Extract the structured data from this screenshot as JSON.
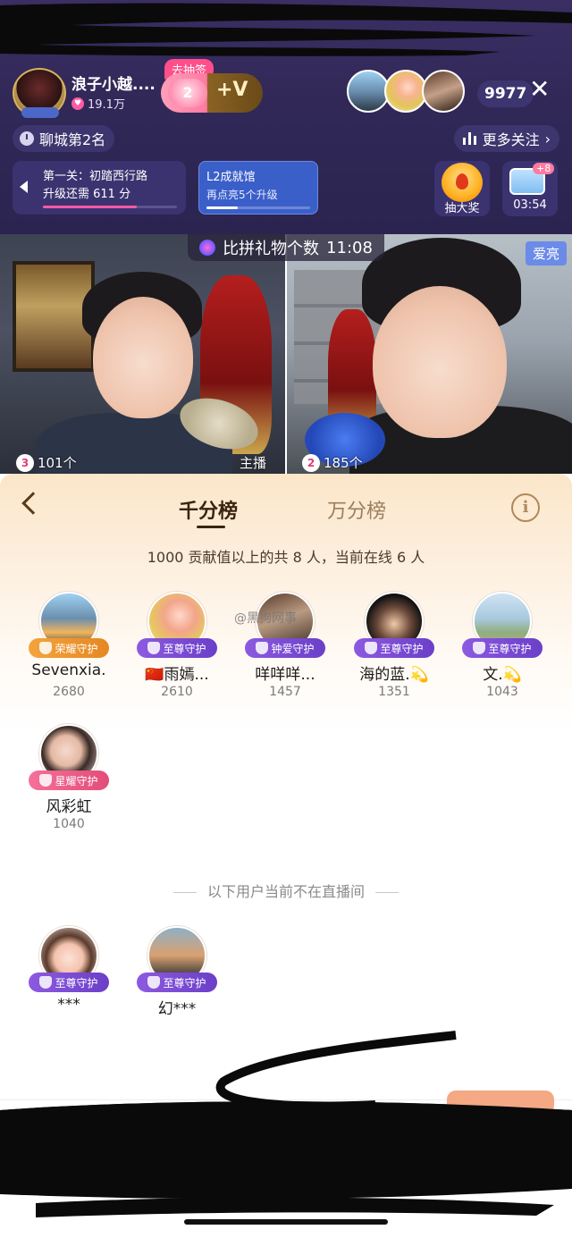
{
  "header": {
    "host_name": "浪子小越....",
    "host_fans": "19.1万",
    "lottery_tag": "去抽签",
    "lottery_level": "2",
    "lottery_v": "+V",
    "viewer_count": "9977",
    "city_rank": "聊城第2名",
    "more_follow": "更多关注",
    "task1_line1": "第一关：初踏西行路",
    "task1_line2": "升级还需 611 分",
    "task1_progress": 0.7,
    "task2_line1": "L2成就馆",
    "task2_line2": "再点亮5个升级",
    "task2_progress": 0.3,
    "draw_prize": "抽大奖",
    "gift_plus": "+8",
    "timer": "03:54"
  },
  "video": {
    "contest_title": "比拼礼物个数",
    "contest_time": "11:08",
    "right_tag": "爱亮",
    "left_rank": "3",
    "left_count": "101个",
    "host_label": "主播",
    "right_rank": "2",
    "right_count": "185个"
  },
  "panel": {
    "tab_active": "千分榜",
    "tab_inactive": "万分榜",
    "summary": "1000 贡献值以上的共 8 人，当前在线 6 人",
    "offline_note": "以下用户当前不在直播间",
    "watermark": "@黑狗网事",
    "online_members": [
      {
        "name": "Sevenxia.",
        "score": "2680",
        "badge": "荣耀守护"
      },
      {
        "name": "🇨🇳雨嫣...",
        "score": "2610",
        "badge": "至尊守护"
      },
      {
        "name": "咩咩咩...",
        "score": "1457",
        "badge": "钟爱守护"
      },
      {
        "name": "海的蓝.💫",
        "score": "1351",
        "badge": "至尊守护"
      },
      {
        "name": "文.💫",
        "score": "1043",
        "badge": "至尊守护"
      },
      {
        "name": "风彩虹",
        "score": "1040",
        "badge": "星耀守护"
      }
    ],
    "offline_members": [
      {
        "name": "***",
        "badge": "至尊守护"
      },
      {
        "name": "幻***",
        "badge": "至尊守护"
      }
    ]
  }
}
